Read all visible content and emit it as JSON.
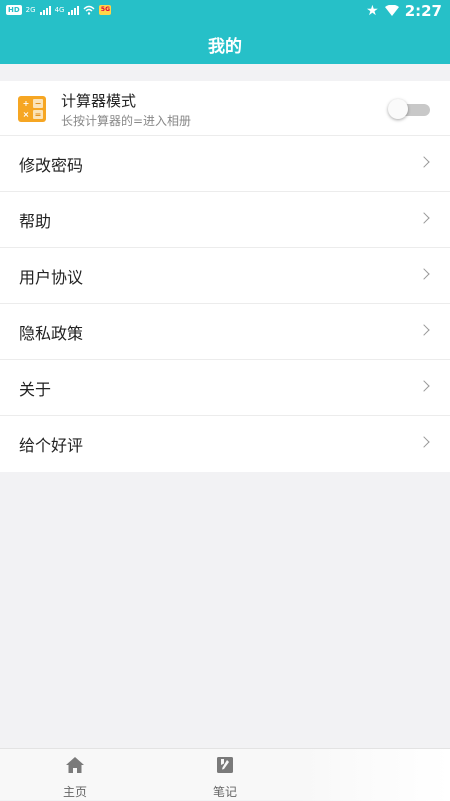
{
  "status_bar": {
    "chips": [
      "HD"
    ],
    "network_labels": [
      "2G",
      "4G"
    ],
    "app_badge": "5G",
    "time": "2:27"
  },
  "header": {
    "title": "我的"
  },
  "calculator_mode": {
    "icon": "calculator-icon",
    "title": "计算器模式",
    "subtitle": "长按计算器的=进入相册",
    "enabled": false
  },
  "menu": {
    "items": [
      {
        "label": "修改密码",
        "icon": "chevron-right-icon"
      },
      {
        "label": "帮助",
        "icon": "chevron-right-icon"
      },
      {
        "label": "用户协议",
        "icon": "chevron-right-icon"
      },
      {
        "label": "隐私政策",
        "icon": "chevron-right-icon"
      },
      {
        "label": "关于",
        "icon": "chevron-right-icon"
      },
      {
        "label": "给个好评",
        "icon": "chevron-right-icon"
      }
    ]
  },
  "bottom_nav": {
    "tabs": [
      {
        "label": "主页",
        "icon": "home-icon"
      },
      {
        "label": "笔记",
        "icon": "notes-icon"
      }
    ]
  },
  "colors": {
    "accent": "#26c0c8",
    "calc_icon": "#f6a623",
    "background": "#f2f2f4"
  }
}
